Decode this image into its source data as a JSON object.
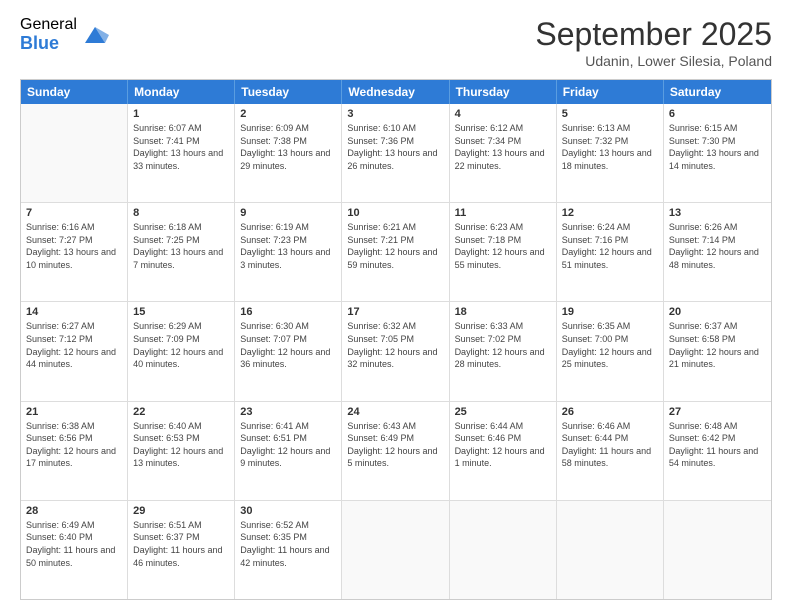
{
  "logo": {
    "general": "General",
    "blue": "Blue"
  },
  "header": {
    "month": "September 2025",
    "location": "Udanin, Lower Silesia, Poland"
  },
  "weekdays": [
    "Sunday",
    "Monday",
    "Tuesday",
    "Wednesday",
    "Thursday",
    "Friday",
    "Saturday"
  ],
  "weeks": [
    [
      {
        "day": "",
        "sunrise": "",
        "sunset": "",
        "daylight": ""
      },
      {
        "day": "1",
        "sunrise": "Sunrise: 6:07 AM",
        "sunset": "Sunset: 7:41 PM",
        "daylight": "Daylight: 13 hours and 33 minutes."
      },
      {
        "day": "2",
        "sunrise": "Sunrise: 6:09 AM",
        "sunset": "Sunset: 7:38 PM",
        "daylight": "Daylight: 13 hours and 29 minutes."
      },
      {
        "day": "3",
        "sunrise": "Sunrise: 6:10 AM",
        "sunset": "Sunset: 7:36 PM",
        "daylight": "Daylight: 13 hours and 26 minutes."
      },
      {
        "day": "4",
        "sunrise": "Sunrise: 6:12 AM",
        "sunset": "Sunset: 7:34 PM",
        "daylight": "Daylight: 13 hours and 22 minutes."
      },
      {
        "day": "5",
        "sunrise": "Sunrise: 6:13 AM",
        "sunset": "Sunset: 7:32 PM",
        "daylight": "Daylight: 13 hours and 18 minutes."
      },
      {
        "day": "6",
        "sunrise": "Sunrise: 6:15 AM",
        "sunset": "Sunset: 7:30 PM",
        "daylight": "Daylight: 13 hours and 14 minutes."
      }
    ],
    [
      {
        "day": "7",
        "sunrise": "Sunrise: 6:16 AM",
        "sunset": "Sunset: 7:27 PM",
        "daylight": "Daylight: 13 hours and 10 minutes."
      },
      {
        "day": "8",
        "sunrise": "Sunrise: 6:18 AM",
        "sunset": "Sunset: 7:25 PM",
        "daylight": "Daylight: 13 hours and 7 minutes."
      },
      {
        "day": "9",
        "sunrise": "Sunrise: 6:19 AM",
        "sunset": "Sunset: 7:23 PM",
        "daylight": "Daylight: 13 hours and 3 minutes."
      },
      {
        "day": "10",
        "sunrise": "Sunrise: 6:21 AM",
        "sunset": "Sunset: 7:21 PM",
        "daylight": "Daylight: 12 hours and 59 minutes."
      },
      {
        "day": "11",
        "sunrise": "Sunrise: 6:23 AM",
        "sunset": "Sunset: 7:18 PM",
        "daylight": "Daylight: 12 hours and 55 minutes."
      },
      {
        "day": "12",
        "sunrise": "Sunrise: 6:24 AM",
        "sunset": "Sunset: 7:16 PM",
        "daylight": "Daylight: 12 hours and 51 minutes."
      },
      {
        "day": "13",
        "sunrise": "Sunrise: 6:26 AM",
        "sunset": "Sunset: 7:14 PM",
        "daylight": "Daylight: 12 hours and 48 minutes."
      }
    ],
    [
      {
        "day": "14",
        "sunrise": "Sunrise: 6:27 AM",
        "sunset": "Sunset: 7:12 PM",
        "daylight": "Daylight: 12 hours and 44 minutes."
      },
      {
        "day": "15",
        "sunrise": "Sunrise: 6:29 AM",
        "sunset": "Sunset: 7:09 PM",
        "daylight": "Daylight: 12 hours and 40 minutes."
      },
      {
        "day": "16",
        "sunrise": "Sunrise: 6:30 AM",
        "sunset": "Sunset: 7:07 PM",
        "daylight": "Daylight: 12 hours and 36 minutes."
      },
      {
        "day": "17",
        "sunrise": "Sunrise: 6:32 AM",
        "sunset": "Sunset: 7:05 PM",
        "daylight": "Daylight: 12 hours and 32 minutes."
      },
      {
        "day": "18",
        "sunrise": "Sunrise: 6:33 AM",
        "sunset": "Sunset: 7:02 PM",
        "daylight": "Daylight: 12 hours and 28 minutes."
      },
      {
        "day": "19",
        "sunrise": "Sunrise: 6:35 AM",
        "sunset": "Sunset: 7:00 PM",
        "daylight": "Daylight: 12 hours and 25 minutes."
      },
      {
        "day": "20",
        "sunrise": "Sunrise: 6:37 AM",
        "sunset": "Sunset: 6:58 PM",
        "daylight": "Daylight: 12 hours and 21 minutes."
      }
    ],
    [
      {
        "day": "21",
        "sunrise": "Sunrise: 6:38 AM",
        "sunset": "Sunset: 6:56 PM",
        "daylight": "Daylight: 12 hours and 17 minutes."
      },
      {
        "day": "22",
        "sunrise": "Sunrise: 6:40 AM",
        "sunset": "Sunset: 6:53 PM",
        "daylight": "Daylight: 12 hours and 13 minutes."
      },
      {
        "day": "23",
        "sunrise": "Sunrise: 6:41 AM",
        "sunset": "Sunset: 6:51 PM",
        "daylight": "Daylight: 12 hours and 9 minutes."
      },
      {
        "day": "24",
        "sunrise": "Sunrise: 6:43 AM",
        "sunset": "Sunset: 6:49 PM",
        "daylight": "Daylight: 12 hours and 5 minutes."
      },
      {
        "day": "25",
        "sunrise": "Sunrise: 6:44 AM",
        "sunset": "Sunset: 6:46 PM",
        "daylight": "Daylight: 12 hours and 1 minute."
      },
      {
        "day": "26",
        "sunrise": "Sunrise: 6:46 AM",
        "sunset": "Sunset: 6:44 PM",
        "daylight": "Daylight: 11 hours and 58 minutes."
      },
      {
        "day": "27",
        "sunrise": "Sunrise: 6:48 AM",
        "sunset": "Sunset: 6:42 PM",
        "daylight": "Daylight: 11 hours and 54 minutes."
      }
    ],
    [
      {
        "day": "28",
        "sunrise": "Sunrise: 6:49 AM",
        "sunset": "Sunset: 6:40 PM",
        "daylight": "Daylight: 11 hours and 50 minutes."
      },
      {
        "day": "29",
        "sunrise": "Sunrise: 6:51 AM",
        "sunset": "Sunset: 6:37 PM",
        "daylight": "Daylight: 11 hours and 46 minutes."
      },
      {
        "day": "30",
        "sunrise": "Sunrise: 6:52 AM",
        "sunset": "Sunset: 6:35 PM",
        "daylight": "Daylight: 11 hours and 42 minutes."
      },
      {
        "day": "",
        "sunrise": "",
        "sunset": "",
        "daylight": ""
      },
      {
        "day": "",
        "sunrise": "",
        "sunset": "",
        "daylight": ""
      },
      {
        "day": "",
        "sunrise": "",
        "sunset": "",
        "daylight": ""
      },
      {
        "day": "",
        "sunrise": "",
        "sunset": "",
        "daylight": ""
      }
    ]
  ]
}
